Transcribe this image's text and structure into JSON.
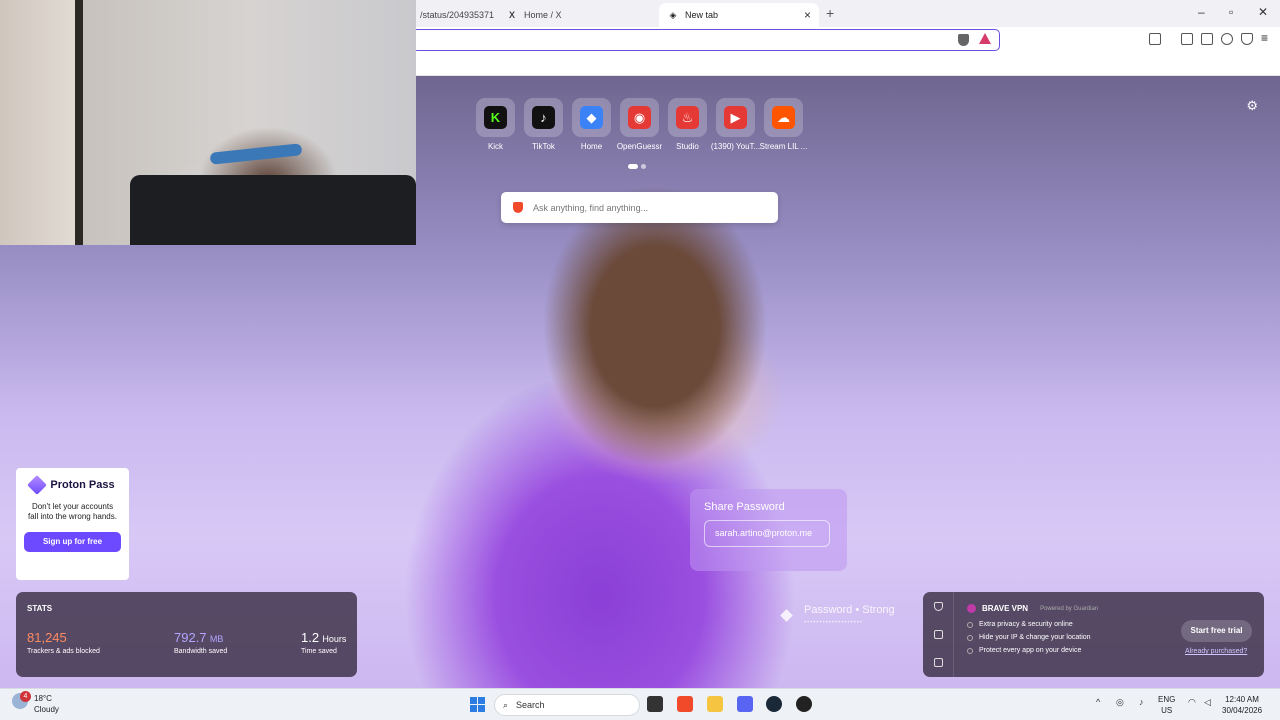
{
  "browser": {
    "tabs": [
      {
        "label": "/status/204935371",
        "icon": "x-icon"
      },
      {
        "label": "Home / X",
        "icon": "x-icon"
      },
      {
        "label": "New tab",
        "icon": "brave-shield-icon"
      }
    ],
    "accent": "#6b4de6"
  },
  "ntp": {
    "shortcuts": [
      {
        "label": "Kick",
        "icon_char": "K",
        "color": "#111111",
        "fg": "#53fc18"
      },
      {
        "label": "TikTok",
        "icon_char": "♪",
        "color": "#111111",
        "fg": "#ffffff"
      },
      {
        "label": "Home",
        "icon_char": "◆",
        "color": "#3b82f6",
        "fg": "#ffffff"
      },
      {
        "label": "OpenGuessr",
        "icon_char": "◉",
        "color": "#e53935",
        "fg": "#ffffff"
      },
      {
        "label": "Studio",
        "icon_char": "♨",
        "color": "#e53935",
        "fg": "#ffffff"
      },
      {
        "label": "(1390) YouT...",
        "icon_char": "▶",
        "color": "#e53935",
        "fg": "#ffffff"
      },
      {
        "label": "Stream LIL ...",
        "icon_char": "☁",
        "color": "#ff5500",
        "fg": "#ffffff"
      }
    ],
    "search_placeholder": "Ask anything, find anything...",
    "proton": {
      "name": "Proton Pass",
      "text": "Don't let your accounts fall into the wrong hands.",
      "button": "Sign up for free"
    },
    "share": {
      "title": "Share Password",
      "email": "sarah.artino@proton.me",
      "strength": "Password • Strong",
      "dots": "•••••••••••••••••••"
    },
    "stats": {
      "title": "STATS",
      "trackers": {
        "value": "81,245",
        "label": "Trackers & ads blocked"
      },
      "bandwidth": {
        "value": "792.7",
        "unit": "MB",
        "label": "Bandwidth saved"
      },
      "time": {
        "value": "1.2",
        "unit": "Hours",
        "label": "Time saved"
      }
    },
    "vpn": {
      "title": "BRAVE VPN",
      "powered": "Powered by Guardian",
      "features": [
        "Extra privacy & security online",
        "Hide your IP & change your location",
        "Protect every app on your device"
      ],
      "button": "Start free trial",
      "link": "Already purchased?"
    }
  },
  "taskbar": {
    "weather": {
      "temp": "18°C",
      "condition": "Cloudy",
      "badge": "4"
    },
    "search": "Search",
    "lang": {
      "line1": "ENG",
      "line2": "US"
    },
    "clock": {
      "time": "12:40 AM",
      "date": "30/04/2026"
    }
  }
}
